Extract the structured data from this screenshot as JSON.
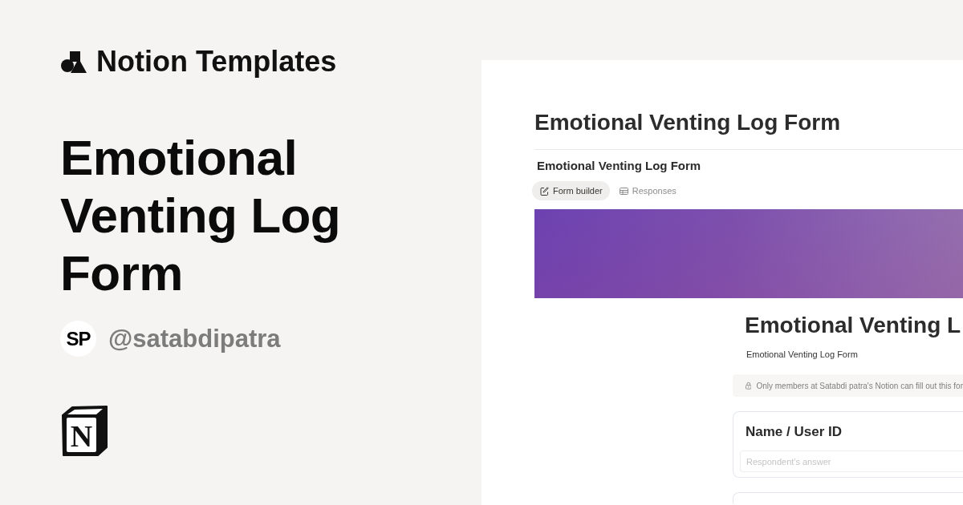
{
  "brand": {
    "name": "Notion Templates"
  },
  "template": {
    "title": "Emotional Venting Log Form"
  },
  "author": {
    "initials": "SP",
    "handle": "@satabdipatra"
  },
  "logo": {
    "letter": "N"
  },
  "preview": {
    "page_title": "Emotional Venting Log Form",
    "database_title": "Emotional Venting Log Form",
    "tabs": [
      {
        "label": "Form builder",
        "selected": true,
        "kind": "form"
      },
      {
        "label": "Responses",
        "selected": false,
        "kind": "table"
      }
    ],
    "form": {
      "title": "Emotional Venting L",
      "description": "Emotional Venting Log Form",
      "notice": "Only members at Satabdi patra's Notion can fill out this for",
      "questions": [
        {
          "label": "Name / User ID",
          "placeholder": "Respondent's answer"
        }
      ]
    }
  }
}
